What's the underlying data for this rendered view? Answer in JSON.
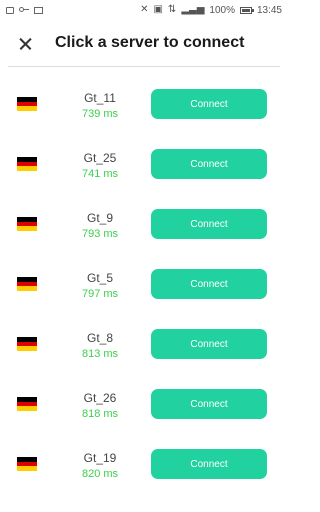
{
  "status_bar": {
    "battery": "100%",
    "time": "13:45",
    "left_icons": [
      "image-icon",
      "key-icon",
      "mail-icon"
    ],
    "right_icons": [
      "mute-icon",
      "sim-icon",
      "data-icon",
      "signal-icon",
      "battery-icon"
    ]
  },
  "header": {
    "title": "Click a server to connect",
    "close_icon": "close-icon"
  },
  "colors": {
    "connect_button": "#21d19f",
    "ping_text": "#3dcf4d",
    "flag_colors": [
      "#000000",
      "#dd0000",
      "#ffce00"
    ]
  },
  "servers": [
    {
      "name": "Gt_11",
      "ping": "739 ms",
      "flag": "germany-flag-icon",
      "button": "Connect"
    },
    {
      "name": "Gt_25",
      "ping": "741 ms",
      "flag": "germany-flag-icon",
      "button": "Connect"
    },
    {
      "name": "Gt_9",
      "ping": "793 ms",
      "flag": "germany-flag-icon",
      "button": "Connect"
    },
    {
      "name": "Gt_5",
      "ping": "797 ms",
      "flag": "germany-flag-icon",
      "button": "Connect"
    },
    {
      "name": "Gt_8",
      "ping": "813 ms",
      "flag": "germany-flag-icon",
      "button": "Connect"
    },
    {
      "name": "Gt_26",
      "ping": "818 ms",
      "flag": "germany-flag-icon",
      "button": "Connect"
    },
    {
      "name": "Gt_19",
      "ping": "820 ms",
      "flag": "germany-flag-icon",
      "button": "Connect"
    }
  ]
}
